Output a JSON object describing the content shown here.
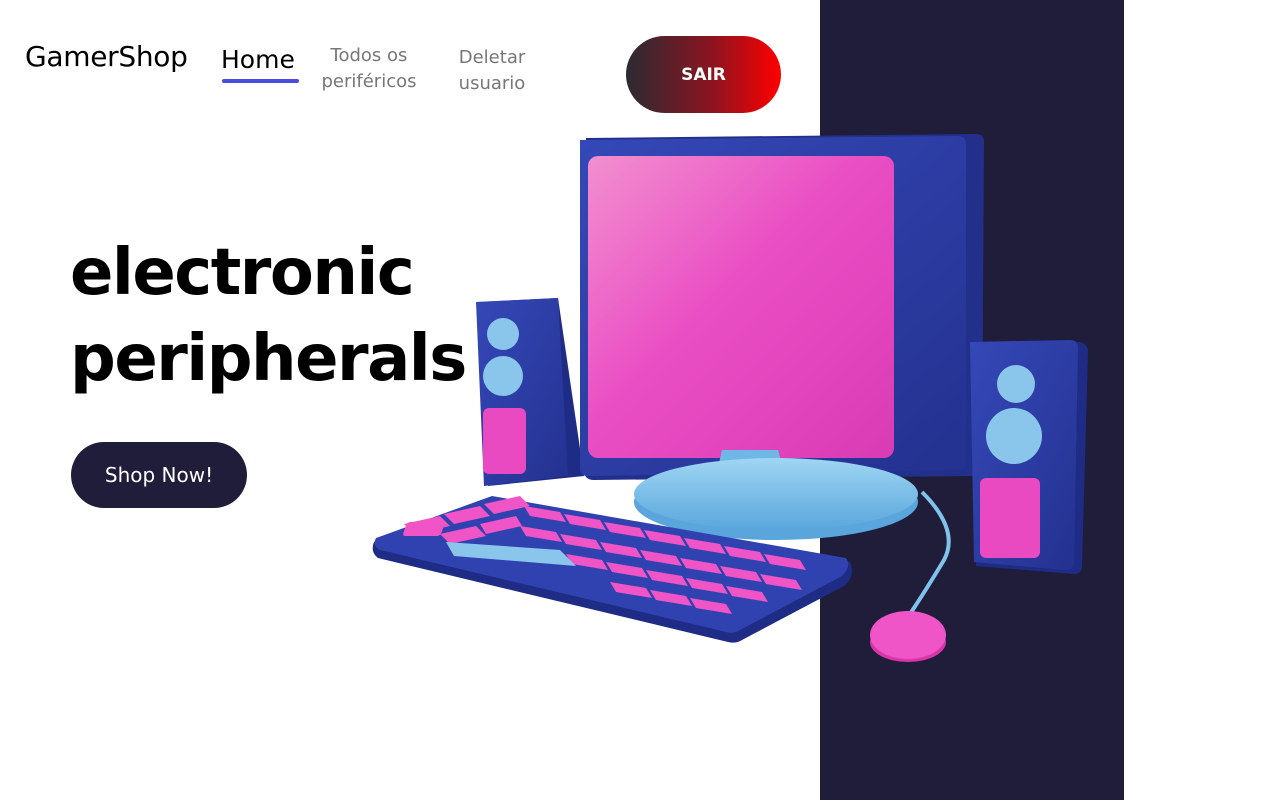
{
  "header": {
    "logo": "GamerShop",
    "nav": {
      "home": "Home",
      "todos_line1": "Todos os",
      "todos_line2": "periféricos",
      "deletar_line1": "Deletar",
      "deletar_line2": "usuario"
    },
    "logout_label": "SAIR"
  },
  "hero": {
    "title_line1": "electronic",
    "title_line2": "peripherals",
    "cta_label": "Shop Now!",
    "illustration": "computer-peripherals-illustration"
  },
  "colors": {
    "dark_panel": "#1f1d3a",
    "nav_underline": "#4b4bdc",
    "logout_gradient_start": "#2b2b33",
    "logout_gradient_end": "#ff0000",
    "accent_pink": "#e93fbf",
    "accent_blue": "#2d3fa8",
    "accent_light_blue": "#7fc2ea"
  }
}
